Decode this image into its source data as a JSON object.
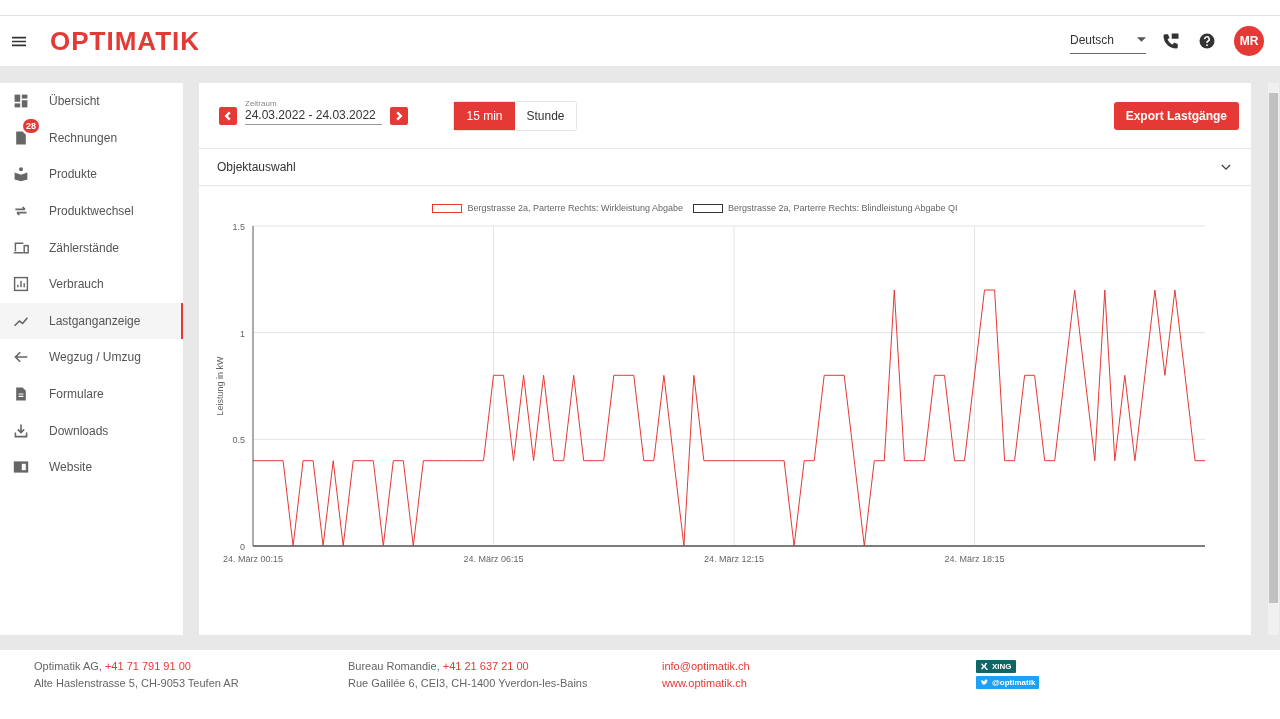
{
  "header": {
    "logo": "OPTIMATIK",
    "language": "Deutsch",
    "avatar": "MR"
  },
  "sidebar": {
    "items": [
      {
        "label": "Übersicht",
        "selected": false
      },
      {
        "label": "Rechnungen",
        "selected": false,
        "badge": "28"
      },
      {
        "label": "Produkte",
        "selected": false
      },
      {
        "label": "Produktwechsel",
        "selected": false
      },
      {
        "label": "Zählerstände",
        "selected": false
      },
      {
        "label": "Verbrauch",
        "selected": false
      },
      {
        "label": "Lastganganzeige",
        "selected": true
      },
      {
        "label": "Wegzug / Umzug",
        "selected": false
      },
      {
        "label": "Formulare",
        "selected": false
      },
      {
        "label": "Downloads",
        "selected": false
      },
      {
        "label": "Website",
        "selected": false
      }
    ]
  },
  "toolbar": {
    "period_label": "Zeitraum",
    "period_value": "24.03.2022 - 24.03.2022",
    "intervals": [
      {
        "label": "15 min",
        "selected": true
      },
      {
        "label": "Stunde",
        "selected": false
      }
    ],
    "export_button": "Export Lastgänge"
  },
  "object_selection": {
    "label": "Objektauswahl",
    "expanded": false
  },
  "chart_data": {
    "type": "line",
    "ylabel": "Leistung in kW",
    "ylim": [
      0,
      1.5
    ],
    "yticks": [
      0,
      0.5,
      1,
      1.5
    ],
    "grid": true,
    "categories": [
      "24. März  00:15",
      null,
      null,
      null,
      null,
      null,
      null,
      null,
      null,
      null,
      null,
      null,
      null,
      null,
      null,
      null,
      null,
      null,
      null,
      null,
      null,
      null,
      null,
      null,
      "24. März  06:15",
      null,
      null,
      null,
      null,
      null,
      null,
      null,
      null,
      null,
      null,
      null,
      null,
      null,
      null,
      null,
      null,
      null,
      null,
      null,
      null,
      null,
      null,
      null,
      "24. März  12:15",
      null,
      null,
      null,
      null,
      null,
      null,
      null,
      null,
      null,
      null,
      null,
      null,
      null,
      null,
      null,
      null,
      null,
      null,
      null,
      null,
      null,
      null,
      null,
      "24. März  18:15",
      null,
      null,
      null,
      null,
      null,
      null,
      null,
      null,
      null,
      null,
      null,
      null,
      null,
      null,
      null,
      null,
      null,
      null,
      null,
      null,
      null,
      null,
      null
    ],
    "series": [
      {
        "name": "Bergstrasse 2a, Parterre Rechts: Wirkleistung Abgabe",
        "color": "#e53935",
        "values": [
          0.4,
          0.4,
          0.4,
          0.4,
          0,
          0.4,
          0.4,
          0,
          0.4,
          0,
          0.4,
          0.4,
          0.4,
          0,
          0.4,
          0.4,
          0,
          0.4,
          0.4,
          0.4,
          0.4,
          0.4,
          0.4,
          0.4,
          0.8,
          0.8,
          0.4,
          0.8,
          0.4,
          0.8,
          0.4,
          0.4,
          0.8,
          0.4,
          0.4,
          0.4,
          0.8,
          0.8,
          0.8,
          0.4,
          0.4,
          0.8,
          0.4,
          0,
          0.8,
          0.4,
          0.4,
          0.4,
          0.4,
          0.4,
          0.4,
          0.4,
          0.4,
          0.4,
          0,
          0.4,
          0.4,
          0.8,
          0.8,
          0.8,
          0.4,
          0,
          0.4,
          0.4,
          1.2,
          0.4,
          0.4,
          0.4,
          0.8,
          0.8,
          0.4,
          0.4,
          0.8,
          1.2,
          1.2,
          0.4,
          0.4,
          0.8,
          0.8,
          0.4,
          0.4,
          0.8,
          1.2,
          0.8,
          0.4,
          1.2,
          0.4,
          0.8,
          0.4,
          0.8,
          1.2,
          0.8,
          1.2,
          0.8,
          0.4,
          0.4
        ]
      },
      {
        "name": "Bergstrasse 2a, Parterre Rechts: Blindleistung Abgabe QI",
        "color": "#333333",
        "values": [
          0,
          0,
          0,
          0,
          0,
          0,
          0,
          0,
          0,
          0,
          0,
          0,
          0,
          0,
          0,
          0,
          0,
          0,
          0,
          0,
          0,
          0,
          0,
          0,
          0,
          0,
          0,
          0,
          0,
          0,
          0,
          0,
          0,
          0,
          0,
          0,
          0,
          0,
          0,
          0,
          0,
          0,
          0,
          0,
          0,
          0,
          0,
          0,
          0,
          0,
          0,
          0,
          0,
          0,
          0,
          0,
          0,
          0,
          0,
          0,
          0,
          0,
          0,
          0,
          0,
          0,
          0,
          0,
          0,
          0,
          0,
          0,
          0,
          0,
          0,
          0,
          0,
          0,
          0,
          0,
          0,
          0,
          0,
          0,
          0,
          0,
          0,
          0,
          0,
          0,
          0,
          0,
          0,
          0,
          0,
          0
        ]
      }
    ]
  },
  "footer": {
    "columns": [
      {
        "name": "Optimatik AG,",
        "phone": "+41 71 791 91 00",
        "address": "Alte Haslenstrasse 5, CH-9053 Teufen AR"
      },
      {
        "name": "Bureau Romandie,",
        "phone": "+41 21 637 21 00",
        "address": "Rue Galilée 6, CEI3, CH-1400 Yverdon-les-Bains"
      }
    ],
    "email": "info@optimatik.ch",
    "website": "www.optimatik.ch",
    "social": [
      {
        "kind": "xing",
        "label": "XING"
      },
      {
        "kind": "twitter",
        "label": "@optimatik"
      }
    ]
  }
}
